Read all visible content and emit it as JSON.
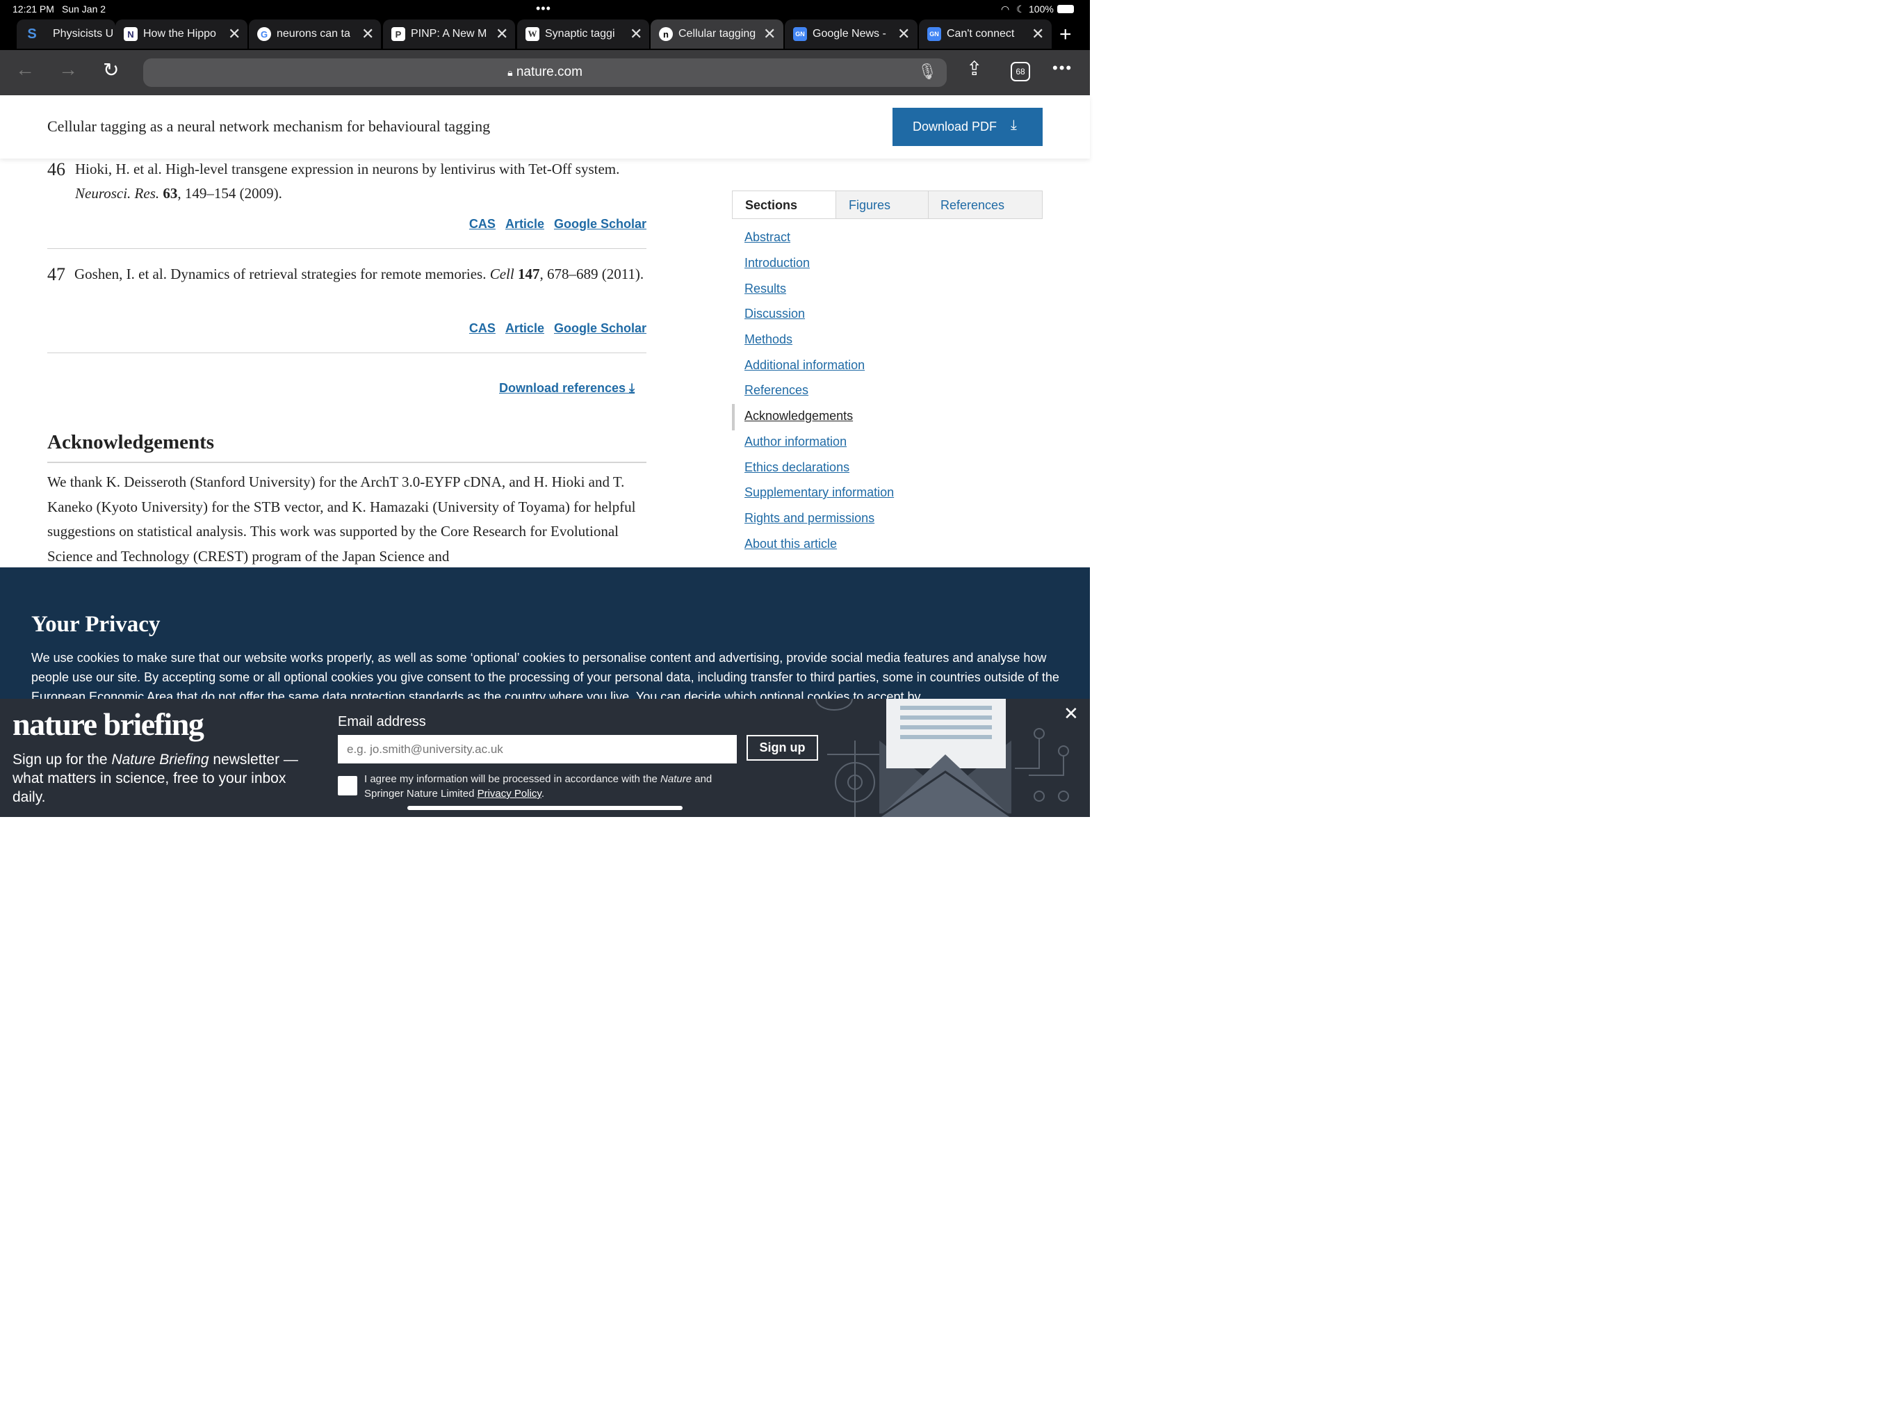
{
  "status": {
    "time": "12:21 PM",
    "date": "Sun Jan 2",
    "battery": "100%"
  },
  "tabs": [
    {
      "label": "Physicists U",
      "icon": "S"
    },
    {
      "label": "How the Hippo",
      "icon": "N"
    },
    {
      "label": "neurons can ta",
      "icon": "G"
    },
    {
      "label": "PINP: A New M",
      "icon": "P"
    },
    {
      "label": "Synaptic taggi",
      "icon": "W"
    },
    {
      "label": "Cellular tagging",
      "icon": "n"
    },
    {
      "label": "Google News -",
      "icon": "GN"
    },
    {
      "label": "Can't connect",
      "icon": "GN"
    }
  ],
  "toolbar": {
    "url": "nature.com",
    "tab_count": "68"
  },
  "article": {
    "title": "Cellular tagging as a neural network mechanism for behavioural tagging",
    "download_pdf": "Download PDF"
  },
  "refs": [
    {
      "num": "46",
      "text_a": "Hioki, H. et al. High-level transgene expression in neurons by lentivirus with Tet-Off system. ",
      "journal": "Neurosci. Res.",
      "vol": "63",
      "text_b": ", 149–154 (2009)."
    },
    {
      "num": "47",
      "text_a": "Goshen, I. et al. Dynamics of retrieval strategies for remote memories. ",
      "journal": "Cell",
      "vol": "147",
      "text_b": ", 678–689 (2011)."
    }
  ],
  "ref_links": {
    "cas": "CAS",
    "article": "Article",
    "scholar": "Google Scholar"
  },
  "download_refs": "Download references",
  "ack": {
    "heading": "Acknowledgements",
    "text": "We thank K. Deisseroth (Stanford University) for the ArchT 3.0-EYFP cDNA, and H. Hioki and T. Kaneko (Kyoto University) for the STB vector, and K. Hamazaki (University of Toyama) for helpful suggestions on statistical analysis. This work was supported by the Core Research for Evolutional Science and Technology (CREST) program of the Japan Science and"
  },
  "sidebar": {
    "tabs": [
      "Sections",
      "Figures",
      "References"
    ],
    "items": [
      "Abstract",
      "Introduction",
      "Results",
      "Discussion",
      "Methods",
      "Additional information",
      "References",
      "Acknowledgements",
      "Author information",
      "Ethics declarations",
      "Supplementary information",
      "Rights and permissions",
      "About this article"
    ],
    "active_item": "Acknowledgements"
  },
  "privacy": {
    "heading": "Your Privacy",
    "text": "We use cookies to make sure that our website works properly, as well as some ‘optional’ cookies to personalise content and advertising, provide social media features and analyse how people use our site. By accepting some or all optional cookies you give consent to the processing of your personal data, including transfer to third parties, some in countries outside of the European Economic Area that do not offer the same data protection standards as the country where you live. You can decide which optional cookies to accept by"
  },
  "briefing": {
    "logo": "nature briefing",
    "desc_a": "Sign up for the ",
    "desc_em": "Nature Briefing",
    "desc_b": " newsletter — what matters in science, free to your inbox daily.",
    "email_label": "Email address",
    "email_placeholder": "e.g. jo.smith@university.ac.uk",
    "signup": "Sign up",
    "agree_a": "I agree my information will be processed in accordance with the ",
    "agree_em": "Nature",
    "agree_b": " and Springer Nature Limited ",
    "agree_link": "Privacy Policy",
    "agree_c": "."
  },
  "colors": {
    "link": "#1f6aa5",
    "privacy_bg": "#16324d",
    "briefing_bg": "#292f38"
  }
}
